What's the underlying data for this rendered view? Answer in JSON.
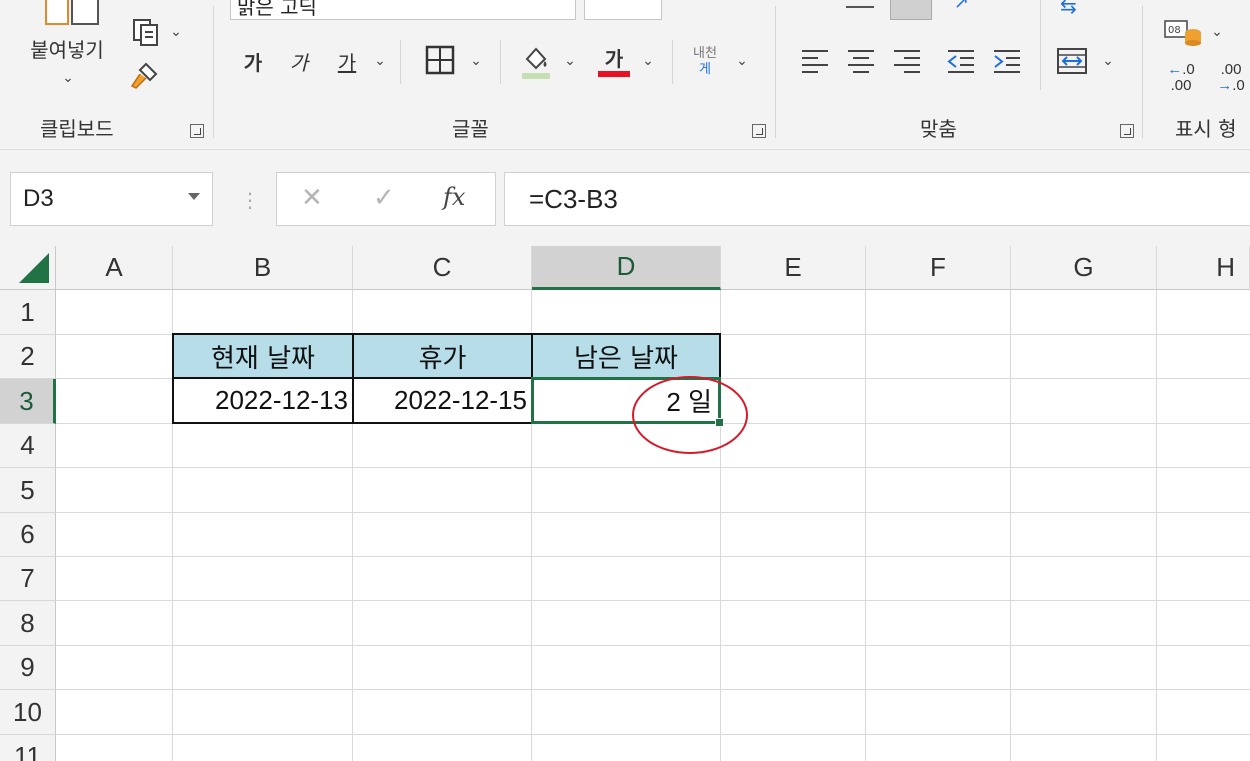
{
  "ribbon": {
    "font_name": "맑은 고딕",
    "clipboard": {
      "paste_label": "붙여넣기",
      "group_label": "클립보드"
    },
    "font": {
      "bold": "가",
      "italic": "가",
      "underline": "가",
      "color_glyph": "가",
      "phonetic_top": "내천",
      "phonetic_bottom": "게",
      "group_label": "글꼴"
    },
    "alignment": {
      "group_label": "맞춤"
    },
    "number": {
      "group_label": "표시 형"
    },
    "colors": {
      "font_color_bar": "#e81123",
      "fill_color_bar": "#c6e0b4"
    }
  },
  "formula_bar": {
    "name_box": "D3",
    "cancel_icon": "✕",
    "enter_icon": "✓",
    "fx_label": "fx",
    "formula": "=C3-B3"
  },
  "sheet": {
    "columns": [
      "A",
      "B",
      "C",
      "D",
      "E",
      "F",
      "G",
      "H"
    ],
    "selected_column": "D",
    "rows": [
      "1",
      "2",
      "3",
      "4",
      "5",
      "6",
      "7",
      "8",
      "9",
      "10",
      "11"
    ],
    "selected_row": "3",
    "table_headers": [
      "현재 날짜",
      "휴가",
      "남은 날짜"
    ],
    "table_values": [
      "2022-12-13",
      "2022-12-15",
      "2 일"
    ],
    "header_fill": "#b7dde8",
    "accent": "#217346",
    "annotation_color": "#d7192a"
  }
}
